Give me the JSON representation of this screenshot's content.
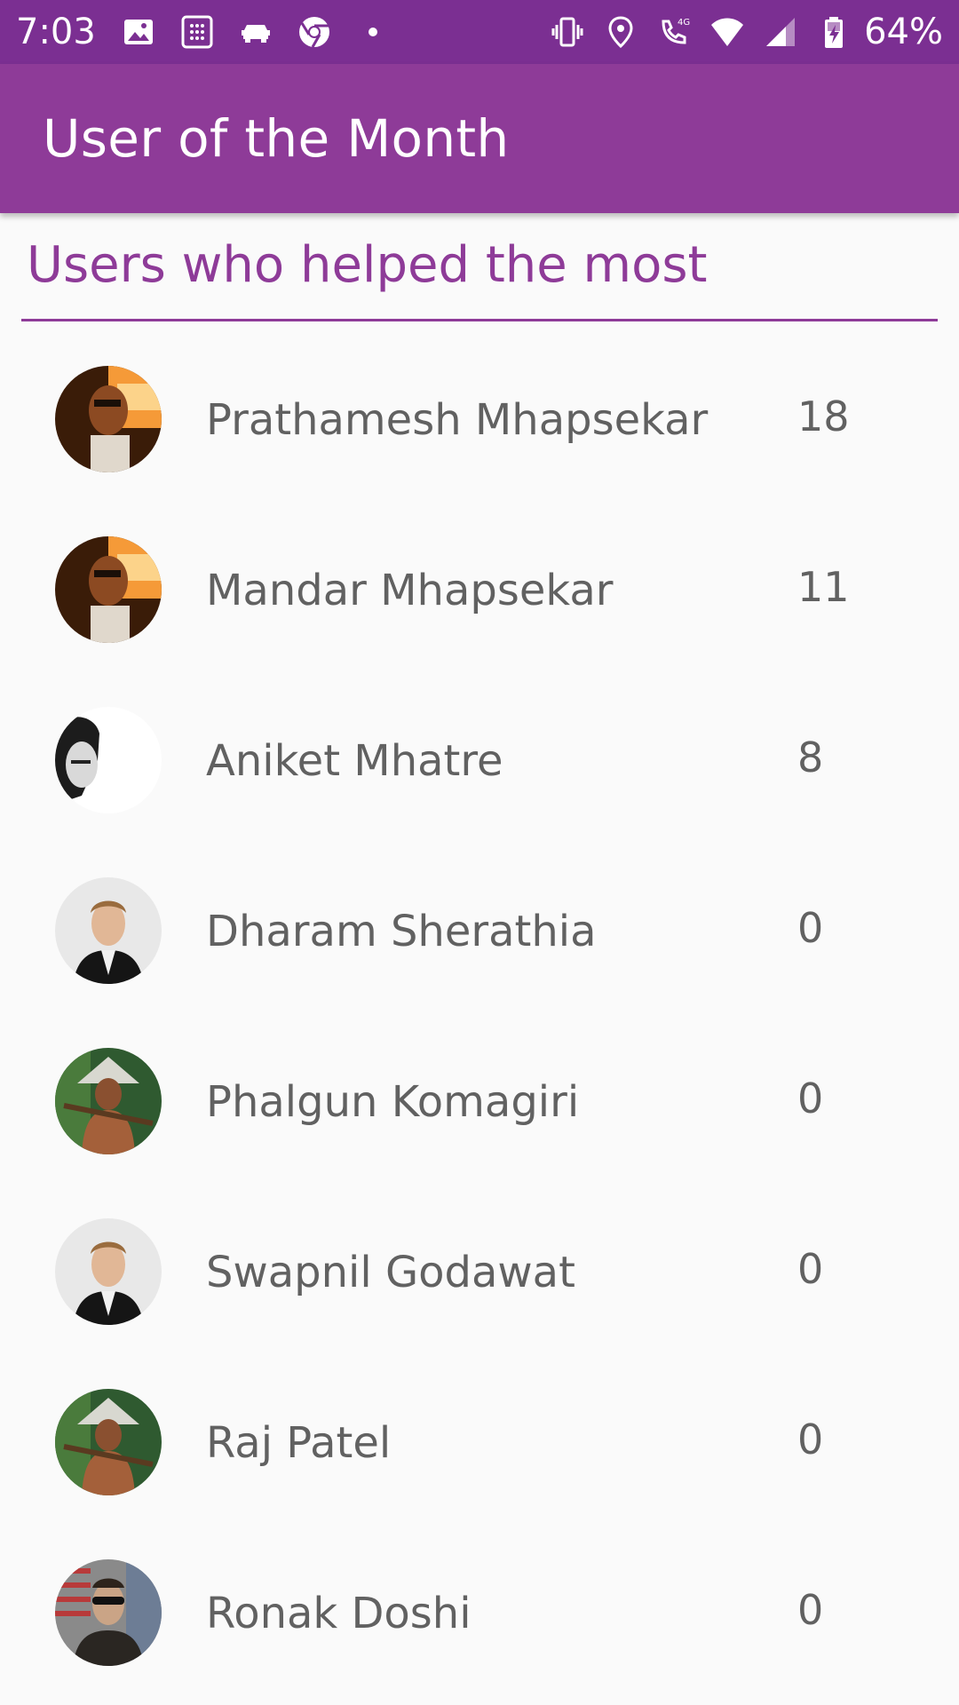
{
  "status_bar": {
    "time": "7:03",
    "battery_percent": "64%",
    "left_icons": [
      "image-icon",
      "calculator-icon",
      "car-icon",
      "chrome-icon",
      "dot-icon"
    ],
    "right_icons": [
      "vibrate-icon",
      "location-icon",
      "wifi-call-icon",
      "wifi-icon",
      "signal-icon",
      "battery-charging-icon"
    ],
    "network_label": "4G",
    "color": "#7b2f92"
  },
  "app_bar": {
    "title": "User of the Month",
    "color": "#8e3b98"
  },
  "section": {
    "title": "Users who helped the most",
    "accent": "#8e3b98"
  },
  "users": [
    {
      "name": "Prathamesh Mhapsekar",
      "score": "18",
      "avatar": "sunset-portrait"
    },
    {
      "name": "Mandar Mhapsekar",
      "score": "11",
      "avatar": "sunset-portrait"
    },
    {
      "name": "Aniket Mhatre",
      "score": "8",
      "avatar": "bw-sketch-portrait"
    },
    {
      "name": "Dharam Sherathia",
      "score": "0",
      "avatar": "suit-portrait"
    },
    {
      "name": "Phalgun Komagiri",
      "score": "0",
      "avatar": "farmer-portrait"
    },
    {
      "name": "Swapnil Godawat",
      "score": "0",
      "avatar": "suit-portrait"
    },
    {
      "name": "Raj Patel",
      "score": "0",
      "avatar": "farmer-portrait"
    },
    {
      "name": "Ronak Doshi",
      "score": "0",
      "avatar": "sunglasses-portrait"
    }
  ]
}
